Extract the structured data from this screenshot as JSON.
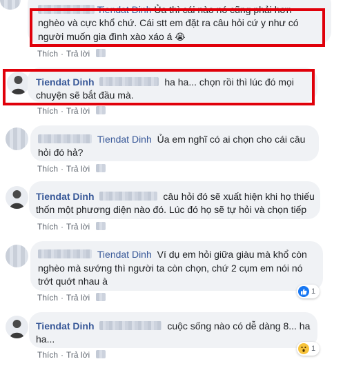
{
  "actions": {
    "like": "Thích",
    "reply": "Trả lời",
    "sep": "·"
  },
  "comments": [
    {
      "author": "Tiendat Dinh",
      "lines": [
        "Ủa thì cái nào nó cũng phải hơn",
        "nghèo và cực khổ chứ. Cái stt em đặt ra câu hỏi cứ y như có",
        "người muốn gia đình xào xáo á"
      ],
      "emoji": "😭"
    },
    {
      "author": "Tiendat Dinh",
      "lines": [
        "ha ha... chọn rồi thì lúc đó mọi",
        "chuyện sẽ bắt đầu mà."
      ]
    },
    {
      "author": "Tiendat Dinh",
      "lines": [
        "Ủa em nghĩ có ai chọn cho cái câu",
        "hỏi đó hả?"
      ]
    },
    {
      "author": "Tiendat Dinh",
      "lines": [
        "câu hỏi đó sẽ xuất hiện khi họ thiếu",
        "thốn một phương diện nào đó. Lúc đó họ sẽ tự hỏi và chọn tiếp"
      ]
    },
    {
      "author": "Tiendat Dinh",
      "lines": [
        "Ví dụ em hỏi giữa giàu mà khổ còn",
        "nghèo mà sướng thì người ta còn chọn, chứ 2 cụm em nói nó",
        "trớt quớt nhau à"
      ],
      "reaction": {
        "type": "like",
        "count": "1"
      }
    },
    {
      "author": "Tiendat Dinh",
      "lines": [
        "cuộc sống nào có dễ dàng 8... ha",
        "ha..."
      ],
      "reaction": {
        "type": "wow",
        "count": "1"
      }
    }
  ],
  "colors": {
    "highlight": "#e0000a",
    "link": "#385898",
    "bubble": "#f0f2f5"
  }
}
